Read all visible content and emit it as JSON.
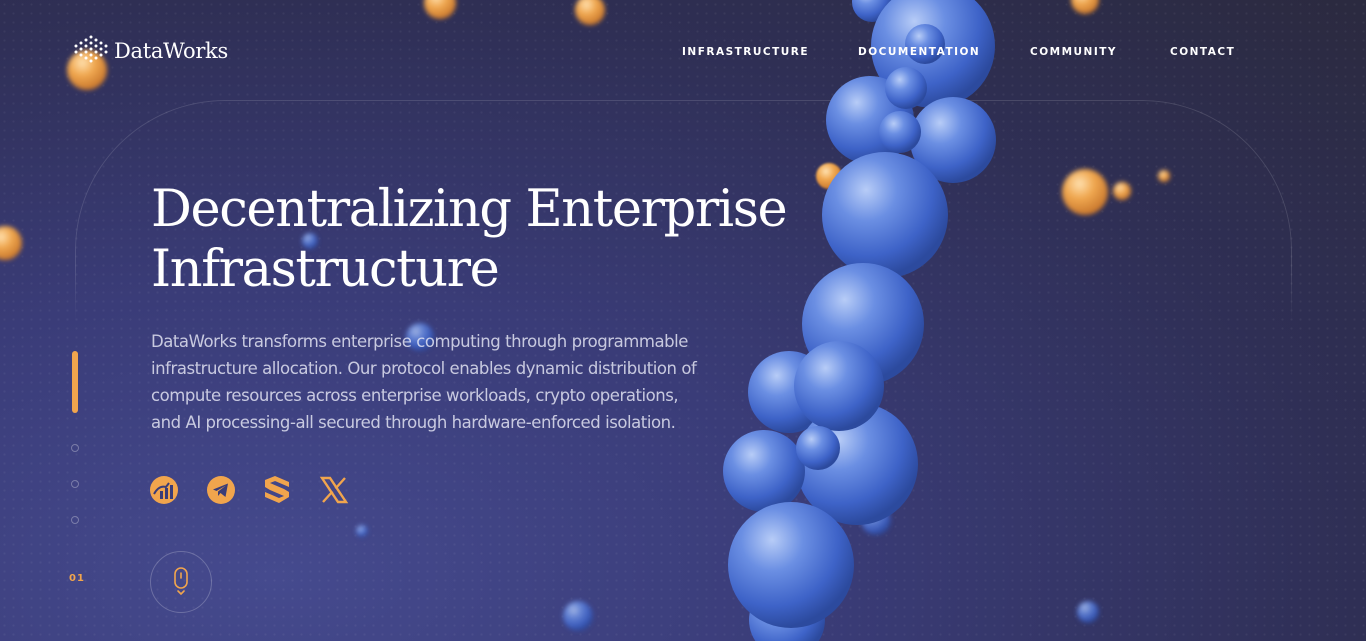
{
  "brand": {
    "name": "DataWorks",
    "accent_color": "#f1a54d",
    "sphere_color": "#4f79d8"
  },
  "nav": {
    "items": [
      "INFRASTRUCTURE",
      "DOCUMENTATION",
      "COMMUNITY",
      "CONTACT"
    ]
  },
  "hero": {
    "title_line1": "Decentralizing Enterprise",
    "title_line2": "Infrastructure",
    "description": "DataWorks transforms enterprise computing through programmable infrastructure allocation. Our protocol enables dynamic distribution of compute resources across enterprise workloads, crypto operations, and AI processing-all secured through hardware-enforced isolation."
  },
  "socials": {
    "items": [
      "chart-icon",
      "telegram-icon",
      "exchange-logo-icon",
      "x-icon"
    ]
  },
  "pager": {
    "current": "01",
    "total_slides": 4
  },
  "scroll": {
    "icon": "mouse-scroll-icon"
  }
}
